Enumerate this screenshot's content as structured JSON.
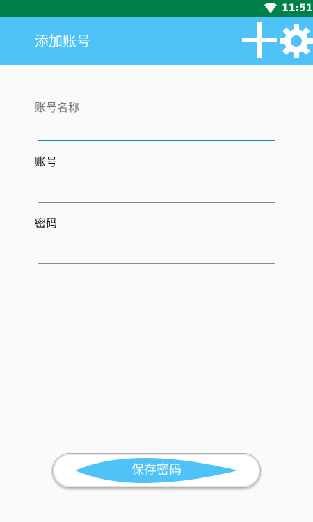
{
  "status_bar": {
    "time": "11:51",
    "wifi_icon": "wifi-icon"
  },
  "app_bar": {
    "title": "添加账号",
    "add_icon": "plus-icon",
    "settings_icon": "gear-icon"
  },
  "form": {
    "fields": [
      {
        "label": "账号名称",
        "value": "",
        "state": "focused"
      },
      {
        "label": "账号",
        "value": "",
        "state": "normal"
      },
      {
        "label": "密码",
        "value": "",
        "state": "normal"
      }
    ]
  },
  "actions": {
    "save_label": "保存密码"
  },
  "colors": {
    "status_bar": "#00804a",
    "app_bar": "#4fc3f7",
    "accent": "#0e8fa6",
    "button_fill": "#4fc3f7"
  }
}
